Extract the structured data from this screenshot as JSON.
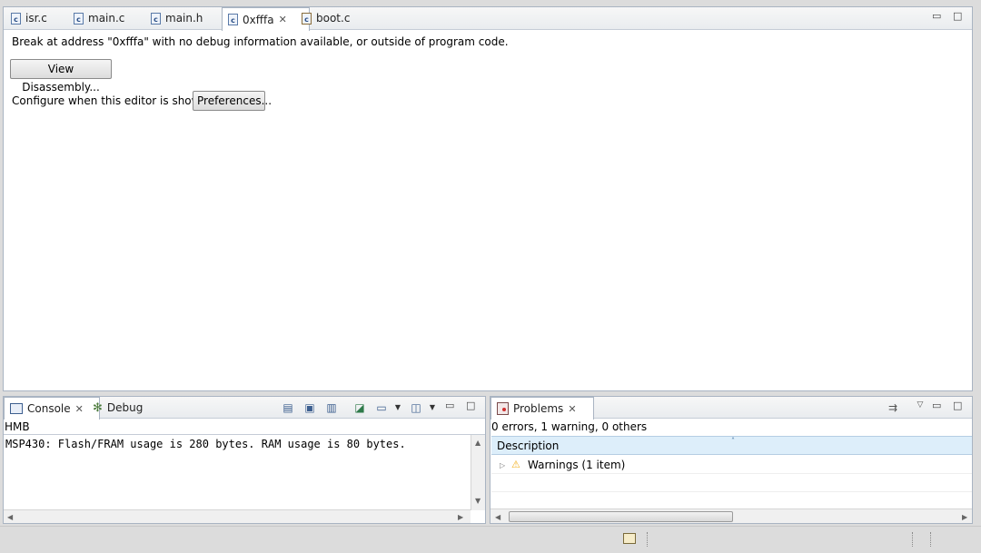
{
  "editor": {
    "tabs": [
      {
        "label": "isr.c"
      },
      {
        "label": "main.c"
      },
      {
        "label": "main.h"
      },
      {
        "label": "0xfffa"
      },
      {
        "label": "boot.c"
      }
    ],
    "message": "Break at address \"0xfffa\" with no debug information available, or outside of program code.",
    "view_disassembly_button": "View Disassembly...",
    "configure_label": "Configure when this editor is shown",
    "preferences_button": "Preferences..."
  },
  "console": {
    "tab_console": "Console",
    "tab_debug": "Debug",
    "header": "HMB",
    "output": "MSP430:  Flash/FRAM usage is 280 bytes. RAM usage is 80 bytes."
  },
  "problems": {
    "tab_label": "Problems",
    "summary": "0 errors, 1 warning, 0 others",
    "column_description": "Description",
    "warnings_row": "Warnings (1 item)"
  },
  "icons": {
    "c_file": "c-file-icon",
    "close": "close-icon",
    "minimize": "minimize-icon",
    "maximize": "maximize-icon",
    "console": "console-icon",
    "debug": "bug-icon",
    "problems": "problems-icon",
    "warning": "warning-icon"
  },
  "colors": {
    "selection_header": "#ddeefa",
    "border": "#a9b4c2",
    "warning": "#f2b01e"
  }
}
